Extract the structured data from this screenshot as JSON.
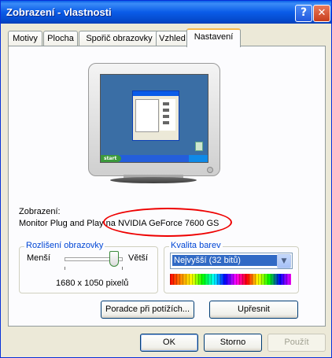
{
  "window": {
    "title": "Zobrazení - vlastnosti",
    "help_glyph": "?",
    "close_glyph": "✕"
  },
  "tabs": [
    {
      "label": "Motivy"
    },
    {
      "label": "Plocha"
    },
    {
      "label": "Spořič obrazovky"
    },
    {
      "label": "Vzhled"
    },
    {
      "label": "Nastavení",
      "active": true
    }
  ],
  "preview": {
    "start_label": "start"
  },
  "display": {
    "heading": "Zobrazení:",
    "device": "Monitor Plug and Play na NVIDIA GeForce 7600 GS"
  },
  "resolution": {
    "group_label": "Rozlišení obrazovky",
    "less_label": "Menší",
    "more_label": "Větší",
    "value": "1680 x 1050 pixelů",
    "slider_position": 0.88
  },
  "color_quality": {
    "group_label": "Kvalita barev",
    "selected": "Nejvyšší (32 bitů)"
  },
  "buttons": {
    "troubleshoot": "Poradce při potížích...",
    "advanced": "Upřesnit",
    "ok": "OK",
    "cancel": "Storno",
    "apply": "Použít"
  },
  "colors": {
    "accent": "#0a5ce8",
    "highlight": "#316ac5",
    "annotation": "#e00000"
  }
}
